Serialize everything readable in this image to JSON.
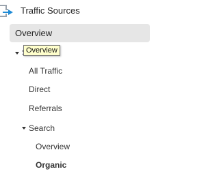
{
  "section": {
    "title": "Traffic Sources",
    "icon": "traffic-sources-icon"
  },
  "nav": {
    "overview_label": "Overview",
    "sources_label": "S",
    "sources_children": {
      "all_traffic": "All Traffic",
      "direct": "Direct",
      "referrals": "Referrals",
      "search": "Search"
    },
    "search_children": {
      "overview": "Overview",
      "organic": "Organic"
    }
  },
  "tooltip": {
    "text": "Overview"
  },
  "colors": {
    "selected_bg": "#e6e6e6",
    "tooltip_bg": "#ffffcc",
    "icon_blue": "#1f8bd6",
    "icon_gray": "#9aa3ad"
  }
}
